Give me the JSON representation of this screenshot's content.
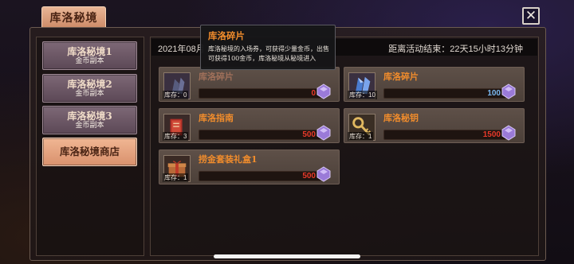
{
  "window": {
    "title": "库洛秘境",
    "close_glyph": "✕"
  },
  "sidebar": {
    "tabs": [
      {
        "label": "库洛秘境1",
        "sub": "金币副本",
        "active": false
      },
      {
        "label": "库洛秘境2",
        "sub": "金币副本",
        "active": false
      },
      {
        "label": "库洛秘境3",
        "sub": "金币副本",
        "active": false
      },
      {
        "label": "库洛秘境商店",
        "sub": "",
        "active": true
      }
    ]
  },
  "header": {
    "date": "2021年08月",
    "countdown": "距离活动结束：22天15小时13分钟"
  },
  "shop": {
    "items": [
      {
        "name": "库洛碎片",
        "stock": "库存：0",
        "price": "0",
        "price_color": "red",
        "icon": "crystal-shard-icon",
        "currency_icon": "purple-gem-icon"
      },
      {
        "name": "库洛碎片",
        "stock": "库存：10",
        "price": "100",
        "price_color": "blue",
        "icon": "crystal-shard-icon",
        "currency_icon": "purple-gem-icon"
      },
      {
        "name": "库洛指南",
        "stock": "库存：3",
        "price": "500",
        "price_color": "red",
        "icon": "guide-book-icon",
        "currency_icon": "purple-gem-icon"
      },
      {
        "name": "库洛秘钥",
        "stock": "库存：1",
        "price": "1500",
        "price_color": "red",
        "icon": "key-icon",
        "currency_icon": "purple-gem-icon"
      },
      {
        "name": "捞金套装礼盒1",
        "stock": "库存：1",
        "price": "500",
        "price_color": "red",
        "icon": "gift-box-icon",
        "currency_icon": "purple-gem-icon"
      }
    ]
  },
  "tooltip": {
    "title": "库洛碎片",
    "body": "库洛秘境的入场券，可获得少量金币，出售可获得100金币，库洛秘境从秘境进入"
  }
}
